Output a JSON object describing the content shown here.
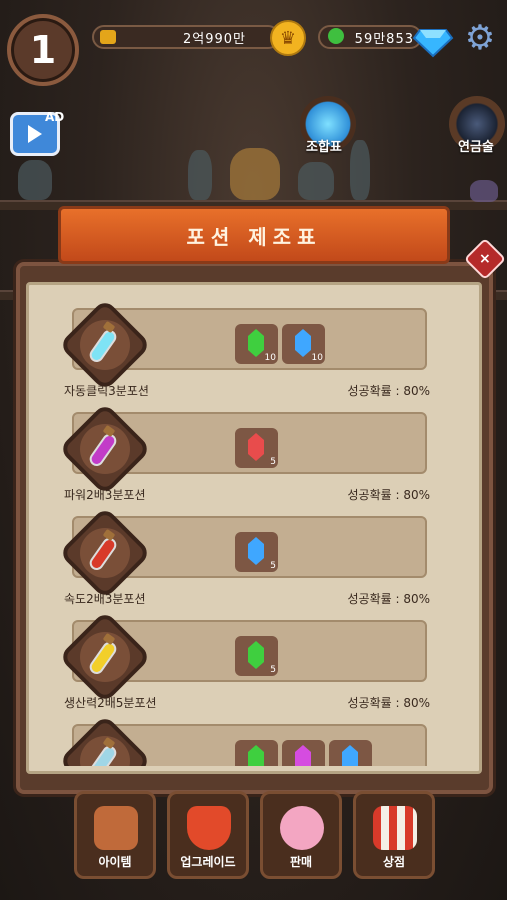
{
  "hud": {
    "level": "1",
    "gold": "2억990만",
    "gems": "59만853",
    "ad_label": "AD"
  },
  "top_menu": {
    "combo_label": "조합표",
    "alchemy_label": "연금술"
  },
  "panel": {
    "title": "포션 제조표",
    "close_label": "×"
  },
  "colors": {
    "green_gem": "#3fcf3f",
    "blue_gem": "#3fa7ff",
    "red_gem": "#e84c4c",
    "purple_gem": "#d54ce0"
  },
  "recipes": [
    {
      "name": "자동클릭3분포션",
      "rate": "성공확률 : 80%",
      "potion_color": "#7fe3f5",
      "ingredients": [
        {
          "gem": "green",
          "count": "10"
        },
        {
          "gem": "blue",
          "count": "10"
        }
      ]
    },
    {
      "name": "파워2배3분포션",
      "rate": "성공확률 : 80%",
      "potion_color": "#c23cc8",
      "ingredients": [
        {
          "gem": "red",
          "count": "5"
        }
      ]
    },
    {
      "name": "속도2배3분포션",
      "rate": "성공확률 : 80%",
      "potion_color": "#d83a2a",
      "ingredients": [
        {
          "gem": "blue",
          "count": "5"
        }
      ]
    },
    {
      "name": "생산력2배5분포션",
      "rate": "성공확률 : 80%",
      "potion_color": "#f2cf2a",
      "ingredients": [
        {
          "gem": "green",
          "count": "5"
        }
      ]
    },
    {
      "name": "",
      "rate": "",
      "potion_color": "#9fd6e6",
      "ingredients": [
        {
          "gem": "green",
          "count": ""
        },
        {
          "gem": "purple",
          "count": ""
        },
        {
          "gem": "blue",
          "count": ""
        }
      ]
    }
  ],
  "bottom_nav": [
    {
      "label": "아이템",
      "icon": "backpack-icon"
    },
    {
      "label": "업그레이드",
      "icon": "shield-plus-icon"
    },
    {
      "label": "판매",
      "icon": "piggy-bank-icon"
    },
    {
      "label": "상점",
      "icon": "shop-stall-icon"
    }
  ]
}
